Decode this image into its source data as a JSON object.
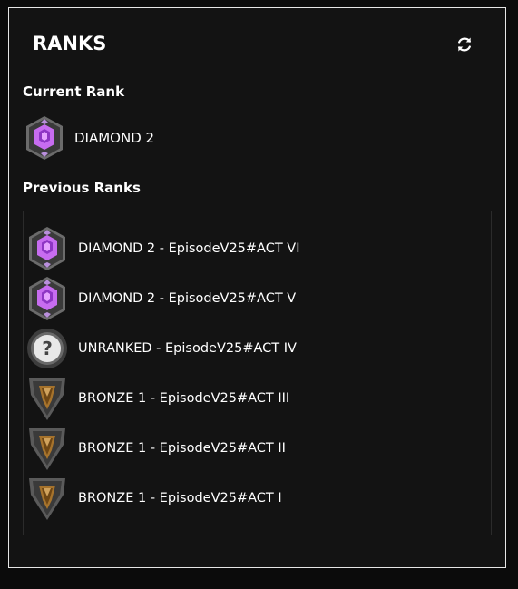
{
  "app": {
    "logo_text": "RANKS"
  },
  "current": {
    "title": "Current Rank",
    "rank": {
      "label": "DIAMOND 2",
      "icon": "diamond-rank-icon"
    }
  },
  "previous": {
    "title": "Previous Ranks",
    "items": [
      {
        "label": "DIAMOND 2 - EpisodeV25#ACT VI",
        "icon": "diamond-rank-icon"
      },
      {
        "label": "DIAMOND 2 - EpisodeV25#ACT V",
        "icon": "diamond-rank-icon"
      },
      {
        "label": "UNRANKED - EpisodeV25#ACT IV",
        "icon": "unranked-icon"
      },
      {
        "label": "BRONZE 1 - EpisodeV25#ACT III",
        "icon": "bronze-rank-icon"
      },
      {
        "label": "BRONZE 1 - EpisodeV25#ACT II",
        "icon": "bronze-rank-icon"
      },
      {
        "label": "BRONZE 1 - EpisodeV25#ACT I",
        "icon": "bronze-rank-icon"
      }
    ]
  },
  "colors": {
    "background": "#131313",
    "border": "#e6e6e6",
    "diamond": "#c76cf0",
    "bronze": "#a6732c",
    "unranked": "#555555"
  }
}
